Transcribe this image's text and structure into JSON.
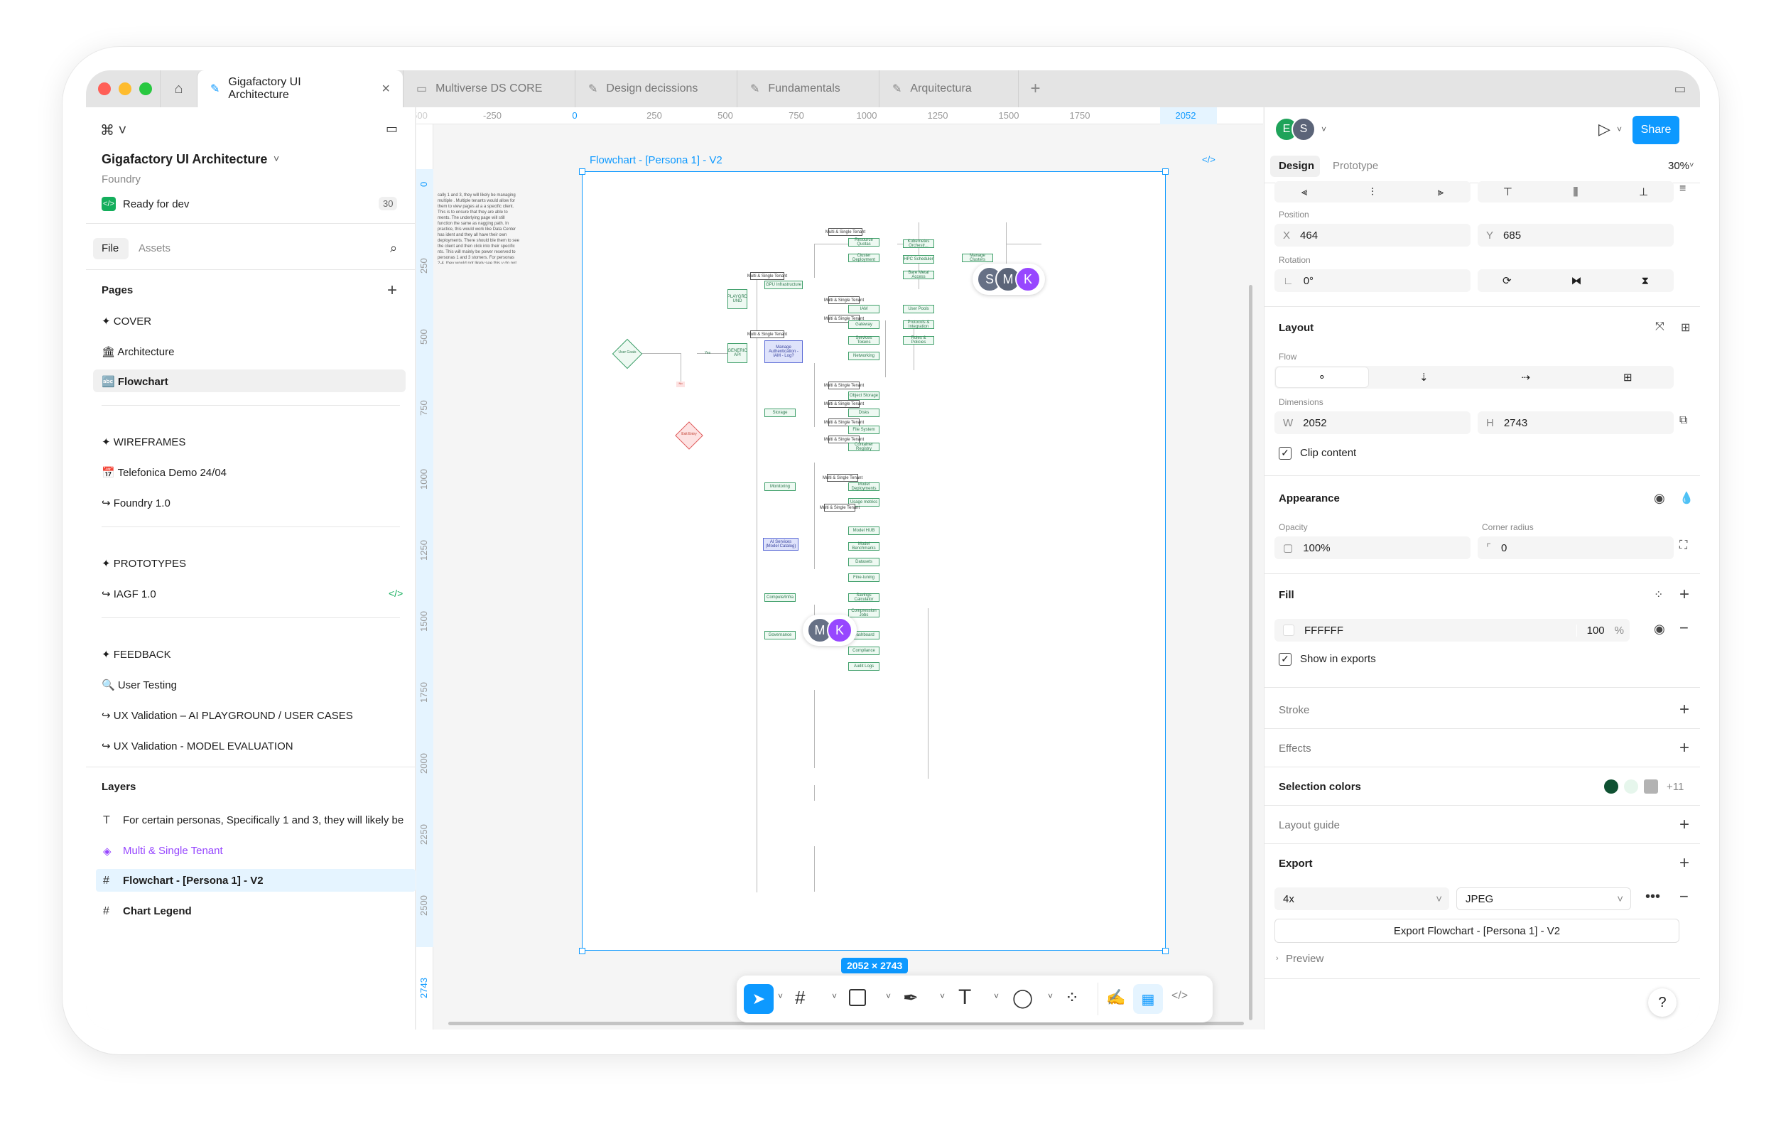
{
  "tabs": [
    {
      "label": "Gigafactory UI Architecture",
      "active": true
    },
    {
      "label": "Multiverse DS CORE"
    },
    {
      "label": "Design decissions"
    },
    {
      "label": "Fundamentals"
    },
    {
      "label": "Arquitectura"
    }
  ],
  "file": {
    "title": "Gigafactory UI Architecture",
    "team": "Foundry",
    "status": "Ready for dev",
    "status_count": "30"
  },
  "panel_tabs": {
    "file": "File",
    "assets": "Assets"
  },
  "pages": {
    "title": "Pages",
    "items": [
      "✦ COVER",
      "🏛 Architecture",
      "🔤 Flowchart",
      "✦ WIREFRAMES",
      "📅 Telefonica Demo  24/04",
      "↪ Foundry 1.0",
      "✦ PROTOTYPES",
      "↪ IAGF 1.0",
      "✦ FEEDBACK",
      "🔍 User Testing",
      "↪ UX Validation – AI PLAYGROUND / USER CASES",
      "↪ UX Validation - MODEL EVALUATION"
    ]
  },
  "layers": {
    "title": "Layers",
    "items": [
      {
        "icon": "T",
        "label": "For certain personas, Specifically 1 and 3, they will likely be"
      },
      {
        "icon": "◈",
        "label": "Multi & Single Tenant"
      },
      {
        "icon": "#",
        "label": "Flowchart - [Persona 1] - V2"
      },
      {
        "icon": "#",
        "label": "Chart Legend"
      }
    ]
  },
  "ruler": {
    "top": [
      "-250",
      "0",
      "250",
      "500",
      "750",
      "1000",
      "1250",
      "1500",
      "1750",
      "2052"
    ],
    "left": [
      "0",
      "250",
      "500",
      "750",
      "1000",
      "1250",
      "1500",
      "1750",
      "2000",
      "2250",
      "2500",
      "2743"
    ]
  },
  "canvas": {
    "frame_label": "Flowchart - [Persona 1] - V2",
    "size_badge": "2052 × 2743",
    "note": "cally 1 and 3, they will likely be managing multiple . Multiple tenants would allow for them to view pages at a a specific client. This is to ensure that they are able to ments. The underlying page will still function the same as nagging path. In practice, this would work like Data Center has ident and they all have their own deployments. There should ble them to see the client and then click into their specific nts. This will mainly be power reserved to personas 1 and 3 stomers. For personas 2-4, they would not likely see this y do not edit/control another customers deployment"
  },
  "flow": {
    "nodes": [
      "User Goals",
      "Yes",
      "No",
      "Exit Entry",
      "PLAYGRD UND",
      "GENERIC API",
      "Manage Authentication - IAM - Log?",
      "GPU Infrastructure",
      "Resource Quotas",
      "Cluster Deployment",
      "Kubernetes Orchestr...",
      "HPC Scheduler",
      "Bare Metal Access",
      "Manage Clusters",
      "IAM",
      "Gateway",
      "Services Tokens",
      "Networking",
      "User Pools",
      "Protocols & Integration",
      "Roles & Policies",
      "Storage",
      "Object Storage",
      "Disks",
      "File System",
      "Container Registry",
      "Monitoring",
      "Model Deployments",
      "Usage metrics",
      "AI Services (Model Catalog)",
      "Model HUB",
      "Model Benchmarks",
      "Datasets",
      "Fine-tuning",
      "Compute/Infra",
      "Savings Calculator",
      "Compression Jobs",
      "Governance",
      "Dashboard",
      "Compliance",
      "Audit Logs"
    ],
    "tag": "Multi & Single Tenant",
    "avatars_top": [
      "S",
      "M",
      "K"
    ],
    "avatars_mid": [
      "M",
      "K"
    ]
  },
  "right": {
    "avatars": [
      "E",
      "S"
    ],
    "share": "Share",
    "tabs": {
      "design": "Design",
      "prototype": "Prototype"
    },
    "zoom": "30%",
    "position_label": "Position",
    "x_label": "X",
    "x": "464",
    "y_label": "Y",
    "y": "685",
    "rotation_label": "Rotation",
    "rotation": "0°",
    "layout": "Layout",
    "flow": "Flow",
    "dimensions": "Dimensions",
    "w_label": "W",
    "w": "2052",
    "h_label": "H",
    "h": "2743",
    "clip": "Clip content",
    "appearance": "Appearance",
    "opacity_label": "Opacity",
    "opacity": "100%",
    "radius_label": "Corner radius",
    "radius": "0",
    "fill": "Fill",
    "fill_hex": "FFFFFF",
    "fill_opacity": "100",
    "fill_pct": "%",
    "show_exports": "Show in exports",
    "stroke": "Stroke",
    "effects": "Effects",
    "selection_colors": "Selection colors",
    "selection_more": "+11",
    "layout_guide": "Layout guide",
    "export": "Export",
    "export_scale": "4x",
    "export_format": "JPEG",
    "export_button": "Export Flowchart - [Persona 1] - V2",
    "preview": "Preview",
    "help": "?"
  },
  "colors": {
    "accent": "#0d99ff",
    "node_green": "#3f9f6a",
    "node_blue": "#5b6bd6",
    "avatar_e": "#1fa35a",
    "avatar_s": "#5b6478",
    "avatar_m": "#667085",
    "avatar_k": "#9747ff",
    "sel1": "#0f5132",
    "sel2": "#e6f6ec",
    "sel3": "#b3b3b3"
  }
}
